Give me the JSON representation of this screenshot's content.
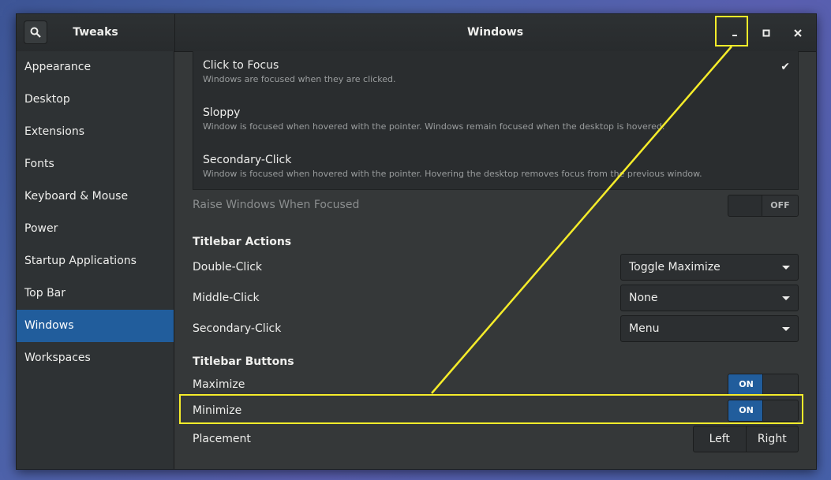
{
  "window": {
    "sidebar_title": "Tweaks",
    "title": "Windows",
    "controls": {
      "minimize": "minimize-icon",
      "maximize": "maximize-icon",
      "close": "close-icon"
    }
  },
  "sidebar": {
    "items": [
      "Appearance",
      "Desktop",
      "Extensions",
      "Fonts",
      "Keyboard & Mouse",
      "Power",
      "Startup Applications",
      "Top Bar",
      "Windows",
      "Workspaces"
    ],
    "selected": "Windows"
  },
  "focus_modes": [
    {
      "title": "Click to Focus",
      "desc": "Windows are focused when they are clicked.",
      "selected": true
    },
    {
      "title": "Sloppy",
      "desc": "Window is focused when hovered with the pointer. Windows remain focused when the desktop is hovered."
    },
    {
      "title": "Secondary-Click",
      "desc": "Window is focused when hovered with the pointer. Hovering the desktop removes focus from the previous window."
    }
  ],
  "raise": {
    "label": "Raise Windows When Focused",
    "state": "OFF"
  },
  "titlebar_actions": {
    "heading": "Titlebar Actions",
    "rows": [
      {
        "label": "Double-Click",
        "value": "Toggle Maximize"
      },
      {
        "label": "Middle-Click",
        "value": "None"
      },
      {
        "label": "Secondary-Click",
        "value": "Menu"
      }
    ]
  },
  "titlebar_buttons": {
    "heading": "Titlebar Buttons",
    "maximize": {
      "label": "Maximize",
      "state": "ON"
    },
    "minimize": {
      "label": "Minimize",
      "state": "ON"
    },
    "placement": {
      "label": "Placement",
      "left": "Left",
      "right": "Right"
    }
  },
  "colors": {
    "accent": "#215d9c",
    "annotation": "#f5ec2a"
  }
}
